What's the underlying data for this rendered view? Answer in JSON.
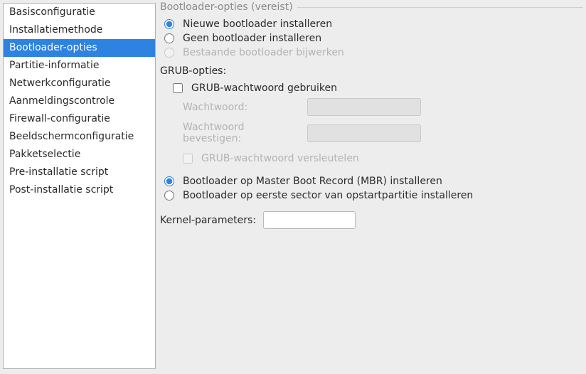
{
  "sidebar": {
    "items": [
      {
        "label": "Basisconfiguratie"
      },
      {
        "label": "Installatiemethode"
      },
      {
        "label": "Bootloader-opties",
        "selected": true
      },
      {
        "label": "Partitie-informatie"
      },
      {
        "label": "Netwerkconfiguratie"
      },
      {
        "label": "Aanmeldingscontrole"
      },
      {
        "label": "Firewall-configuratie"
      },
      {
        "label": "Beeldschermconfiguratie"
      },
      {
        "label": "Pakketselectie"
      },
      {
        "label": "Pre-installatie script"
      },
      {
        "label": "Post-installatie script"
      }
    ]
  },
  "main": {
    "section_title": "Bootloader-opties (vereist)",
    "bootloader_choice": {
      "install_new": "Nieuwe bootloader installeren",
      "none": "Geen bootloader installeren",
      "update_existing": "Bestaande bootloader bijwerken"
    },
    "grub": {
      "title": "GRUB-opties:",
      "use_password": "GRUB-wachtwoord gebruiken",
      "password_label": "Wachtwoord:",
      "confirm_label": "Wachtwoord bevestigen:",
      "encrypt": "GRUB-wachtwoord versleutelen"
    },
    "install_location": {
      "mbr": "Bootloader op Master Boot Record (MBR) installeren",
      "first_sector": "Bootloader op eerste sector van opstartpartitie installeren"
    },
    "kernel": {
      "label": "Kernel-parameters:",
      "value": ""
    }
  }
}
